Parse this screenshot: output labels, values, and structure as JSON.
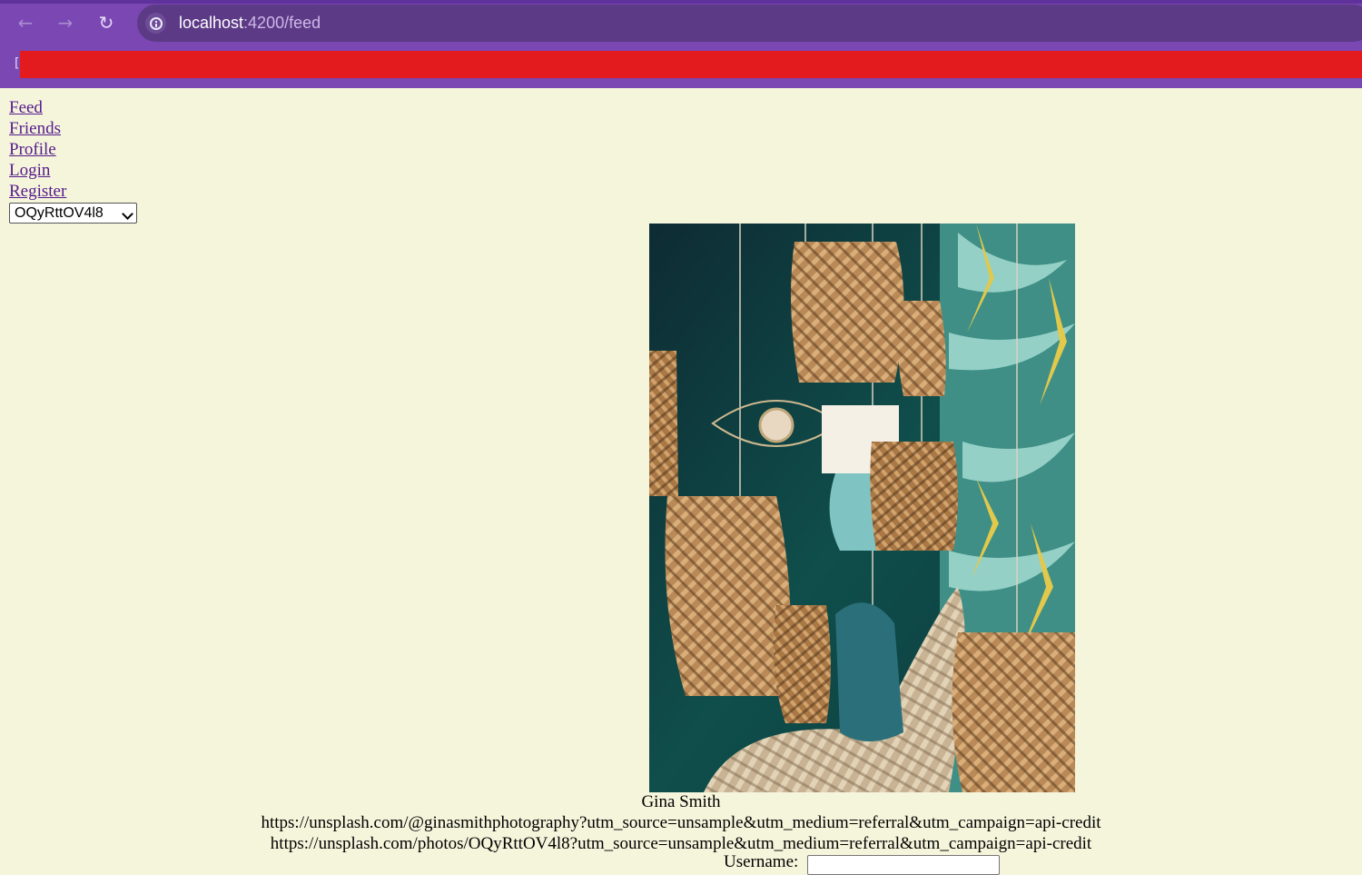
{
  "browser": {
    "url_host": "localhost",
    "url_path": ":4200/feed"
  },
  "nav": {
    "links": [
      "Feed",
      "Friends",
      "Profile",
      "Login",
      "Register"
    ]
  },
  "photo_select": {
    "selected": "OQyRttOV4l8"
  },
  "post": {
    "author": "Gina Smith",
    "author_url": "https://unsplash.com/@ginasmithphotography?utm_source=unsample&utm_medium=referral&utm_campaign=api-credit",
    "photo_url": "https://unsplash.com/photos/OQyRttOV4l8?utm_source=unsample&utm_medium=referral&utm_campaign=api-credit",
    "username_label": "Username:"
  },
  "colors": {
    "page_bg": "#f5f5dc",
    "chrome_bg": "#7a47b3",
    "redaction": "#e41b1e",
    "link": "#551a8b"
  }
}
